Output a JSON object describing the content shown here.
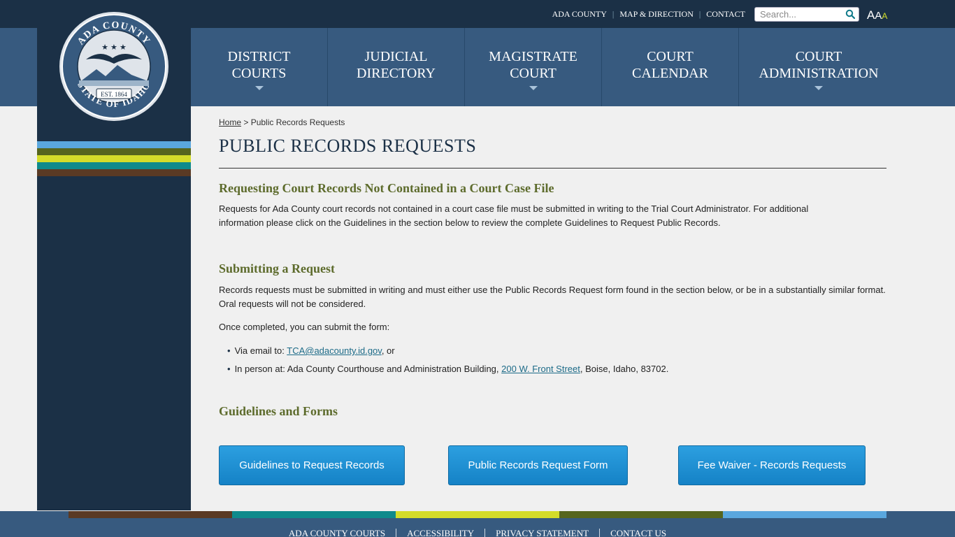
{
  "utility": {
    "links": [
      "ADA COUNTY",
      "MAP & DIRECTION",
      "CONTACT"
    ],
    "search_placeholder": "Search...",
    "font_size_labels": [
      "A",
      "A",
      "A"
    ]
  },
  "seal": {
    "top_text": "ADA COUNTY",
    "bottom_text": "STATE OF IDAHO",
    "est_text": "EST. 1864"
  },
  "nav": {
    "items": [
      {
        "label": "DISTRICT COURTS",
        "has_dropdown": true
      },
      {
        "label": "JUDICIAL DIRECTORY",
        "has_dropdown": false
      },
      {
        "label": "MAGISTRATE COURT",
        "has_dropdown": true
      },
      {
        "label": "COURT CALENDAR",
        "has_dropdown": false
      },
      {
        "label": "COURT ADMINISTRATION",
        "has_dropdown": true
      }
    ]
  },
  "breadcrumb": {
    "home": "Home",
    "separator": " > ",
    "current": "Public Records Requests"
  },
  "page": {
    "title": "PUBLIC RECORDS REQUESTS",
    "section1_heading": "Requesting Court Records Not Contained in a Court Case File",
    "section1_text": "Requests for Ada County court records not contained in a court case file must be submitted in writing to the Trial Court Administrator.  For additional information please click on the Guidelines in the section below to review the complete Guidelines to Request Public Records.",
    "section2_heading": "Submitting a Request",
    "section2_text": "Records requests must be submitted in writing and must either use the Public Records Request form found in the section below, or be in a substantially similar format. Oral requests will not be considered.",
    "section2_text2": "Once completed, you can submit the form:",
    "bullet1_prefix": "Via email to: ",
    "bullet1_link": "TCA@adacounty.id.gov",
    "bullet1_suffix": ", or",
    "bullet2_prefix": "In person at:  Ada County Courthouse and Administration Building, ",
    "bullet2_link": "200 W. Front Street",
    "bullet2_suffix": ", Boise, Idaho, 83702.",
    "section3_heading": "Guidelines and Forms",
    "buttons": [
      "Guidelines to Request Records",
      "Public Records Request Form",
      "Fee Waiver - Records Requests"
    ]
  },
  "footer": {
    "links": [
      "ADA COUNTY COURTS",
      "ACCESSIBILITY",
      "PRIVACY STATEMENT",
      "CONTACT US"
    ]
  },
  "colors": {
    "dark_navy": "#1b3046",
    "nav_blue": "#375a7f",
    "heading_olive": "#5d6b2c",
    "button_blue": "#1582c6",
    "stripe_light_blue": "#5aa7de",
    "stripe_olive": "#56651e",
    "stripe_yellow": "#d4dc2a",
    "stripe_teal": "#0f8a8c",
    "stripe_brown": "#5a3a24"
  }
}
